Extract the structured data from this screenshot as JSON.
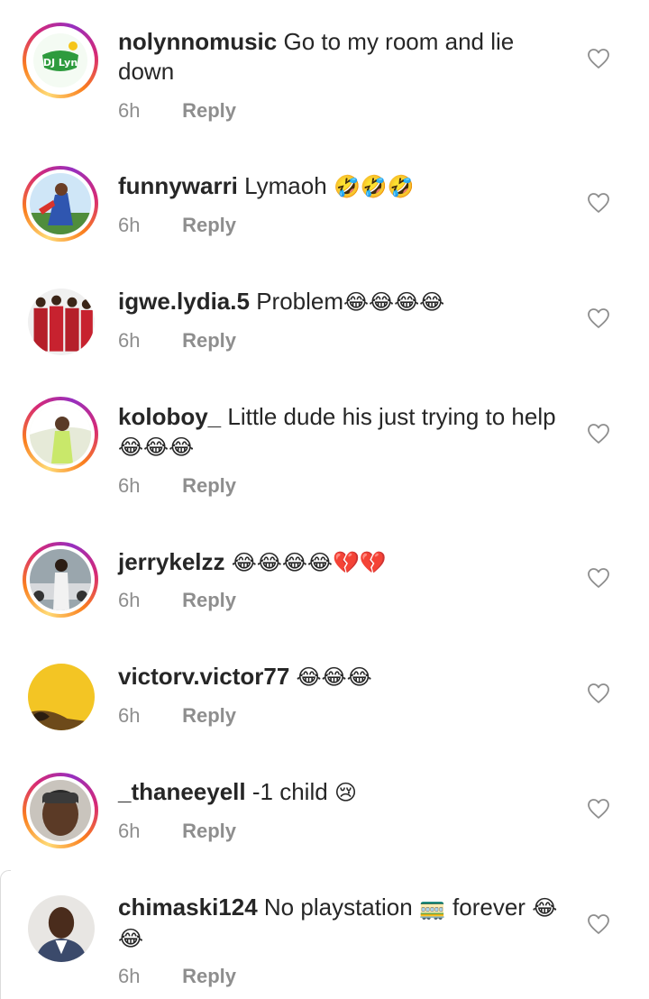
{
  "comments": [
    {
      "username": "nolynnomusic",
      "text": "Go to my room and lie down",
      "emoji": "",
      "time": "6h",
      "reply": "Reply",
      "avatar_label": "DJ Lyn"
    },
    {
      "username": "funnywarri",
      "text": "Lymaoh",
      "emoji": "🤣🤣🤣",
      "time": "6h",
      "reply": "Reply"
    },
    {
      "username": "igwe.lydia.5",
      "text": "Problem",
      "emoji": "😂😂😂😂",
      "time": "6h",
      "reply": "Reply"
    },
    {
      "username": "koloboy_",
      "text": "Little dude his just trying to help",
      "emoji": "😂😂😂",
      "time": "6h",
      "reply": "Reply"
    },
    {
      "username": "jerrykelzz",
      "text": "",
      "emoji": "😂😂😂😂💔💔",
      "time": "6h",
      "reply": "Reply"
    },
    {
      "username": "victorv.victor77",
      "text": "",
      "emoji": "😂😂😂",
      "time": "6h",
      "reply": "Reply"
    },
    {
      "username": "_thaneeyell",
      "text": "-1 child",
      "emoji": "😢",
      "time": "6h",
      "reply": "Reply"
    },
    {
      "username": "chimaski124",
      "text": "No playstation",
      "emoji_mid": "🚃",
      "text2": "forever",
      "emoji": "😂😂",
      "time": "6h",
      "reply": "Reply"
    }
  ],
  "colors": {
    "text": "#262626",
    "muted": "#8e8e8e",
    "story_ring": "#d62976"
  },
  "icons": {
    "like": "heart-outline-icon"
  }
}
